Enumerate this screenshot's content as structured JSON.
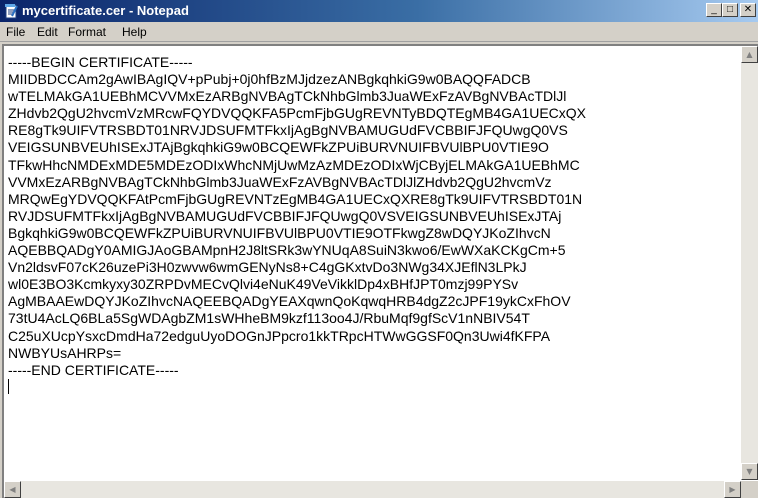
{
  "window": {
    "title": "mycertificate.cer - Notepad",
    "controls": {
      "minimize": "_",
      "maximize": "□",
      "close": "✕"
    }
  },
  "menu": {
    "file": "File",
    "edit": "Edit",
    "format": "Format",
    "help": "Help"
  },
  "document": {
    "lines": [
      "-----BEGIN CERTIFICATE-----",
      "MIIDBDCCAm2gAwIBAgIQV+pPubj+0j0hfBzMJjdzezANBgkqhkiG9w0BAQQFADCB",
      "wTELMAkGA1UEBhMCVVMxEzARBgNVBAgTCkNhbGlmb3JuaWExFzAVBgNVBAcTDlJl",
      "ZHdvb2QgU2hvcmVzMRcwFQYDVQQKFA5PcmFjbGUgREVNTyBDQTEgMB4GA1UECxQX",
      "RE8gTk9UIFVTRSBDT01NRVJDSUFMTFkxIjAgBgNVBAMUGUdFVCBBIFJFQUwgQ0VS",
      "VEIGSUNBVEUhISExJTAjBgkqhkiG9w0BCQEWFkZPUiBURVNUIFBVUlBPU0VTIE9O",
      "TFkwHhcNMDExMDE5MDEzODIxWhcNMjUwMzAzMDEzODIxWjCByjELMAkGA1UEBhMC",
      "VVMxEzARBgNVBAgTCkNhbGlmb3JuaWExFzAVBgNVBAcTDlJlZHdvb2QgU2hvcmVz",
      "MRQwEgYDVQQKFAtPcmFjbGUgREVNTzEgMB4GA1UECxQXRE8gTk9UIFVTRSBDT01N",
      "RVJDSUFMTFkxIjAgBgNVBAMUGUdFVCBBIFJFQUwgQ0VSVEIGSUNBVEUhISExJTAj",
      "BgkqhkiG9w0BCQEWFkZPUiBURVNUIFBVUlBPU0VTIE9OTFkwgZ8wDQYJKoZIhvcN",
      "AQEBBQADgY0AMIGJAoGBAMpnH2J8ltSRk3wYNUqA8SuiN3kwo6/EwWXaKCKgCm+5",
      "Vn2ldsvF07cK26uzePi3H0zwvw6wmGENyNs8+C4gGKxtvDo3NWg34XJEflN3LPkJ",
      "wl0E3BO3Kcmkyxy30ZRPDvMECvQlvi4eNuK49VeVikklDp4xBHfJPT0mzj99PYSv",
      "AgMBAAEwDQYJKoZIhvcNAQEEBQADgYEAXqwnQoKqwqHRB4dgZ2cJPF19ykCxFhOV",
      "73tU4AcLQ6BLa5SgWDAgbZM1sWHheBM9kzf113oo4J/RbuMqf9gfScV1nNBIV54T",
      "C25uXUcpYsxcDmdHa72edguUyoDOGnJPpcro1kkTRpcHTWwGGSF0Qn3Uwi4fKFPA",
      "NWBYUsAHRPs=",
      "-----END CERTIFICATE-----"
    ]
  }
}
